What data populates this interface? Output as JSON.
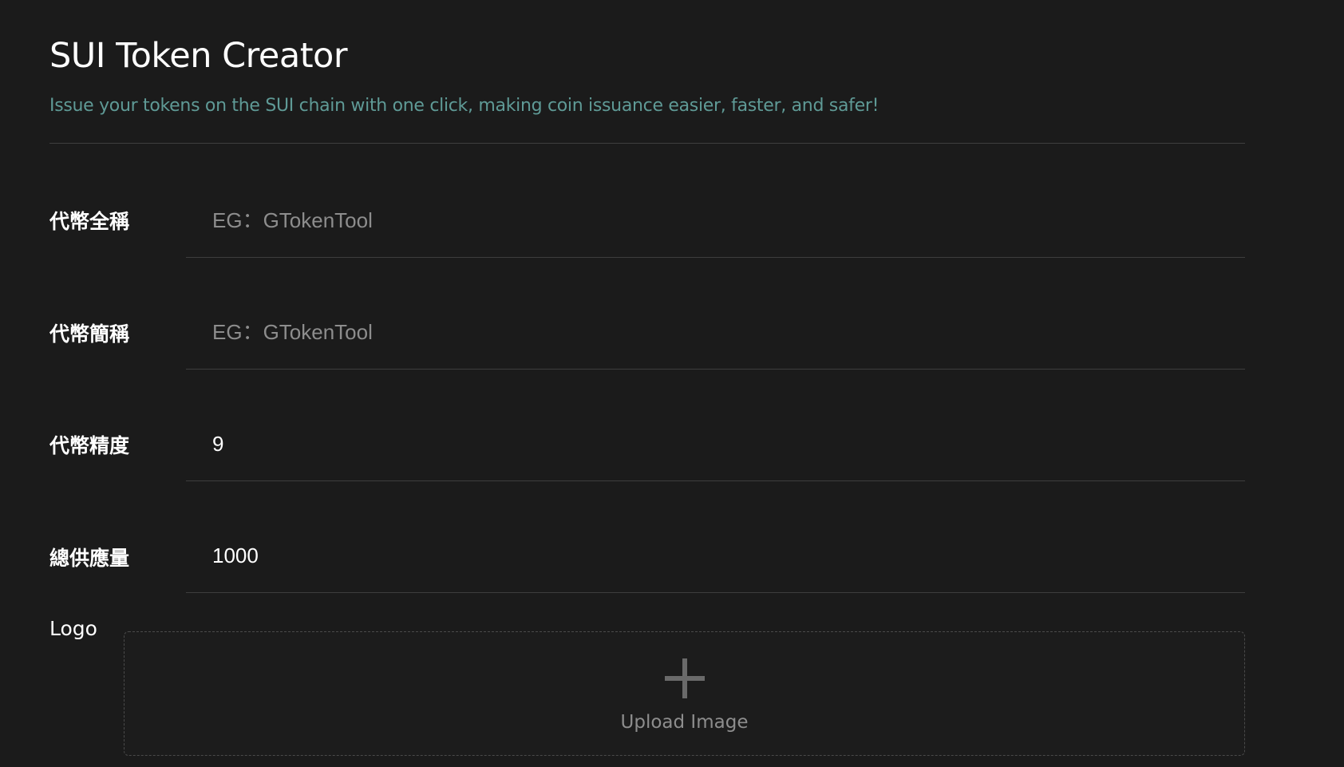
{
  "header": {
    "title": "SUI Token Creator",
    "subtitle": "Issue your tokens on the SUI chain with one click, making coin issuance easier, faster, and safer!"
  },
  "form": {
    "fields": [
      {
        "label": "代幣全稱",
        "value": "",
        "placeholder": "EG：GTokenTool"
      },
      {
        "label": "代幣簡稱",
        "value": "",
        "placeholder": "EG：GTokenTool"
      },
      {
        "label": "代幣精度",
        "value": "9",
        "placeholder": ""
      },
      {
        "label": "總供應量",
        "value": "1000",
        "placeholder": ""
      }
    ],
    "logo": {
      "label": "Logo",
      "upload_text": "Upload Image",
      "icon": "plus-icon"
    }
  },
  "colors": {
    "background": "#1b1b1b",
    "subtitle": "#5f9a96",
    "divider": "#3e3e3e",
    "placeholder": "#8d8d8d"
  }
}
